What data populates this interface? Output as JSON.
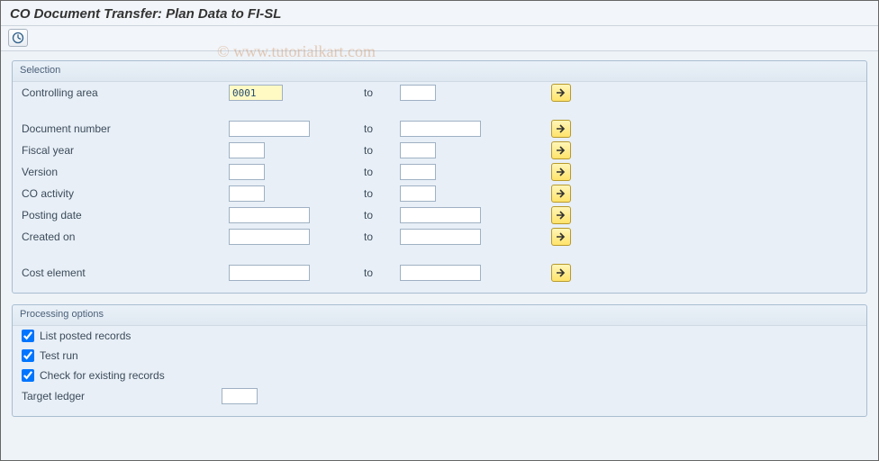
{
  "title": "CO Document Transfer: Plan Data to FI-SL",
  "watermark": "© www.tutorialkart.com",
  "toolbar": {
    "execute_icon": "execute"
  },
  "selection": {
    "title": "Selection",
    "to_label": "to",
    "rows": [
      {
        "label": "Controlling area",
        "from": "0001",
        "to": "",
        "from_w": "w-small",
        "to_w": "w-short",
        "highlight": true
      },
      {
        "spacer": true
      },
      {
        "label": "Document number",
        "from": "",
        "to": "",
        "from_w": "w-med",
        "to_w": "w-med"
      },
      {
        "label": "Fiscal year",
        "from": "",
        "to": "",
        "from_w": "w-short",
        "to_w": "w-short"
      },
      {
        "label": "Version",
        "from": "",
        "to": "",
        "from_w": "w-short",
        "to_w": "w-short"
      },
      {
        "label": "CO activity",
        "from": "",
        "to": "",
        "from_w": "w-short",
        "to_w": "w-short"
      },
      {
        "label": "Posting date",
        "from": "",
        "to": "",
        "from_w": "w-med",
        "to_w": "w-med"
      },
      {
        "label": "Created on",
        "from": "",
        "to": "",
        "from_w": "w-med",
        "to_w": "w-med"
      },
      {
        "spacer": true
      },
      {
        "label": "Cost element",
        "from": "",
        "to": "",
        "from_w": "w-med",
        "to_w": "w-med"
      }
    ]
  },
  "processing": {
    "title": "Processing options",
    "opts": [
      {
        "label": "List posted records",
        "checked": true
      },
      {
        "label": "Test run",
        "checked": true
      },
      {
        "label": "Check for existing records",
        "checked": true
      }
    ],
    "target_ledger_label": "Target ledger",
    "target_ledger_value": ""
  }
}
